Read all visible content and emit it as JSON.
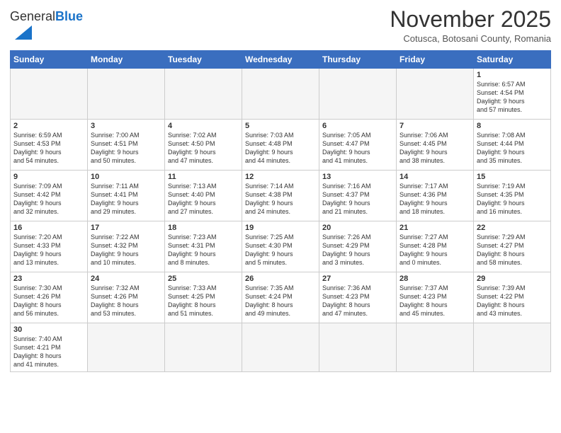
{
  "header": {
    "logo_general": "General",
    "logo_blue": "Blue",
    "month_title": "November 2025",
    "subtitle": "Cotusca, Botosani County, Romania"
  },
  "weekdays": [
    "Sunday",
    "Monday",
    "Tuesday",
    "Wednesday",
    "Thursday",
    "Friday",
    "Saturday"
  ],
  "weeks": [
    [
      {
        "day": "",
        "info": ""
      },
      {
        "day": "",
        "info": ""
      },
      {
        "day": "",
        "info": ""
      },
      {
        "day": "",
        "info": ""
      },
      {
        "day": "",
        "info": ""
      },
      {
        "day": "",
        "info": ""
      },
      {
        "day": "1",
        "info": "Sunrise: 6:57 AM\nSunset: 4:54 PM\nDaylight: 9 hours\nand 57 minutes."
      }
    ],
    [
      {
        "day": "2",
        "info": "Sunrise: 6:59 AM\nSunset: 4:53 PM\nDaylight: 9 hours\nand 54 minutes."
      },
      {
        "day": "3",
        "info": "Sunrise: 7:00 AM\nSunset: 4:51 PM\nDaylight: 9 hours\nand 50 minutes."
      },
      {
        "day": "4",
        "info": "Sunrise: 7:02 AM\nSunset: 4:50 PM\nDaylight: 9 hours\nand 47 minutes."
      },
      {
        "day": "5",
        "info": "Sunrise: 7:03 AM\nSunset: 4:48 PM\nDaylight: 9 hours\nand 44 minutes."
      },
      {
        "day": "6",
        "info": "Sunrise: 7:05 AM\nSunset: 4:47 PM\nDaylight: 9 hours\nand 41 minutes."
      },
      {
        "day": "7",
        "info": "Sunrise: 7:06 AM\nSunset: 4:45 PM\nDaylight: 9 hours\nand 38 minutes."
      },
      {
        "day": "8",
        "info": "Sunrise: 7:08 AM\nSunset: 4:44 PM\nDaylight: 9 hours\nand 35 minutes."
      }
    ],
    [
      {
        "day": "9",
        "info": "Sunrise: 7:09 AM\nSunset: 4:42 PM\nDaylight: 9 hours\nand 32 minutes."
      },
      {
        "day": "10",
        "info": "Sunrise: 7:11 AM\nSunset: 4:41 PM\nDaylight: 9 hours\nand 29 minutes."
      },
      {
        "day": "11",
        "info": "Sunrise: 7:13 AM\nSunset: 4:40 PM\nDaylight: 9 hours\nand 27 minutes."
      },
      {
        "day": "12",
        "info": "Sunrise: 7:14 AM\nSunset: 4:38 PM\nDaylight: 9 hours\nand 24 minutes."
      },
      {
        "day": "13",
        "info": "Sunrise: 7:16 AM\nSunset: 4:37 PM\nDaylight: 9 hours\nand 21 minutes."
      },
      {
        "day": "14",
        "info": "Sunrise: 7:17 AM\nSunset: 4:36 PM\nDaylight: 9 hours\nand 18 minutes."
      },
      {
        "day": "15",
        "info": "Sunrise: 7:19 AM\nSunset: 4:35 PM\nDaylight: 9 hours\nand 16 minutes."
      }
    ],
    [
      {
        "day": "16",
        "info": "Sunrise: 7:20 AM\nSunset: 4:33 PM\nDaylight: 9 hours\nand 13 minutes."
      },
      {
        "day": "17",
        "info": "Sunrise: 7:22 AM\nSunset: 4:32 PM\nDaylight: 9 hours\nand 10 minutes."
      },
      {
        "day": "18",
        "info": "Sunrise: 7:23 AM\nSunset: 4:31 PM\nDaylight: 9 hours\nand 8 minutes."
      },
      {
        "day": "19",
        "info": "Sunrise: 7:25 AM\nSunset: 4:30 PM\nDaylight: 9 hours\nand 5 minutes."
      },
      {
        "day": "20",
        "info": "Sunrise: 7:26 AM\nSunset: 4:29 PM\nDaylight: 9 hours\nand 3 minutes."
      },
      {
        "day": "21",
        "info": "Sunrise: 7:27 AM\nSunset: 4:28 PM\nDaylight: 9 hours\nand 0 minutes."
      },
      {
        "day": "22",
        "info": "Sunrise: 7:29 AM\nSunset: 4:27 PM\nDaylight: 8 hours\nand 58 minutes."
      }
    ],
    [
      {
        "day": "23",
        "info": "Sunrise: 7:30 AM\nSunset: 4:26 PM\nDaylight: 8 hours\nand 56 minutes."
      },
      {
        "day": "24",
        "info": "Sunrise: 7:32 AM\nSunset: 4:26 PM\nDaylight: 8 hours\nand 53 minutes."
      },
      {
        "day": "25",
        "info": "Sunrise: 7:33 AM\nSunset: 4:25 PM\nDaylight: 8 hours\nand 51 minutes."
      },
      {
        "day": "26",
        "info": "Sunrise: 7:35 AM\nSunset: 4:24 PM\nDaylight: 8 hours\nand 49 minutes."
      },
      {
        "day": "27",
        "info": "Sunrise: 7:36 AM\nSunset: 4:23 PM\nDaylight: 8 hours\nand 47 minutes."
      },
      {
        "day": "28",
        "info": "Sunrise: 7:37 AM\nSunset: 4:23 PM\nDaylight: 8 hours\nand 45 minutes."
      },
      {
        "day": "29",
        "info": "Sunrise: 7:39 AM\nSunset: 4:22 PM\nDaylight: 8 hours\nand 43 minutes."
      }
    ],
    [
      {
        "day": "30",
        "info": "Sunrise: 7:40 AM\nSunset: 4:21 PM\nDaylight: 8 hours\nand 41 minutes."
      },
      {
        "day": "",
        "info": ""
      },
      {
        "day": "",
        "info": ""
      },
      {
        "day": "",
        "info": ""
      },
      {
        "day": "",
        "info": ""
      },
      {
        "day": "",
        "info": ""
      },
      {
        "day": "",
        "info": ""
      }
    ]
  ]
}
